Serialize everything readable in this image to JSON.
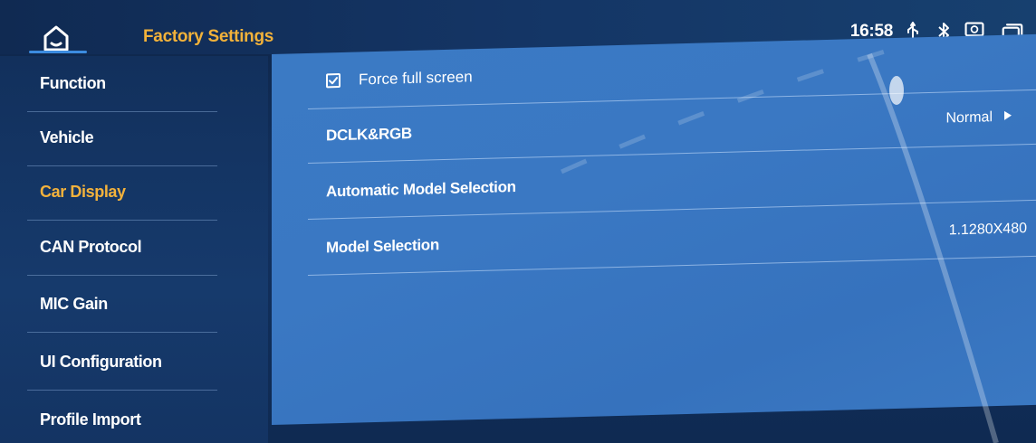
{
  "header": {
    "title": "Factory Settings",
    "time": "16:58",
    "icons": [
      "home-icon",
      "usb-icon",
      "bluetooth-icon",
      "screen-mirror-icon",
      "recent-apps-icon"
    ]
  },
  "sidebar": {
    "items": [
      {
        "label": "Function"
      },
      {
        "label": "Vehicle"
      },
      {
        "label": "Car Display"
      },
      {
        "label": "CAN Protocol"
      },
      {
        "label": "MIC Gain"
      },
      {
        "label": "UI Configuration"
      },
      {
        "label": "Profile Import"
      }
    ],
    "active_item": "Car Display"
  },
  "main": {
    "force_full_screen": {
      "label": "Force full screen",
      "checked": true
    },
    "dclk_rgb": {
      "label": "DCLK&RGB",
      "value": "Normal"
    },
    "automatic_model_selection": {
      "label": "Automatic Model Selection"
    },
    "model_selection": {
      "label": "Model Selection",
      "value": "1.1280X480"
    }
  },
  "colors": {
    "accent_orange": "#f2b23a",
    "panel_blue": "#3a78c3",
    "background_navy": "#12315f"
  }
}
